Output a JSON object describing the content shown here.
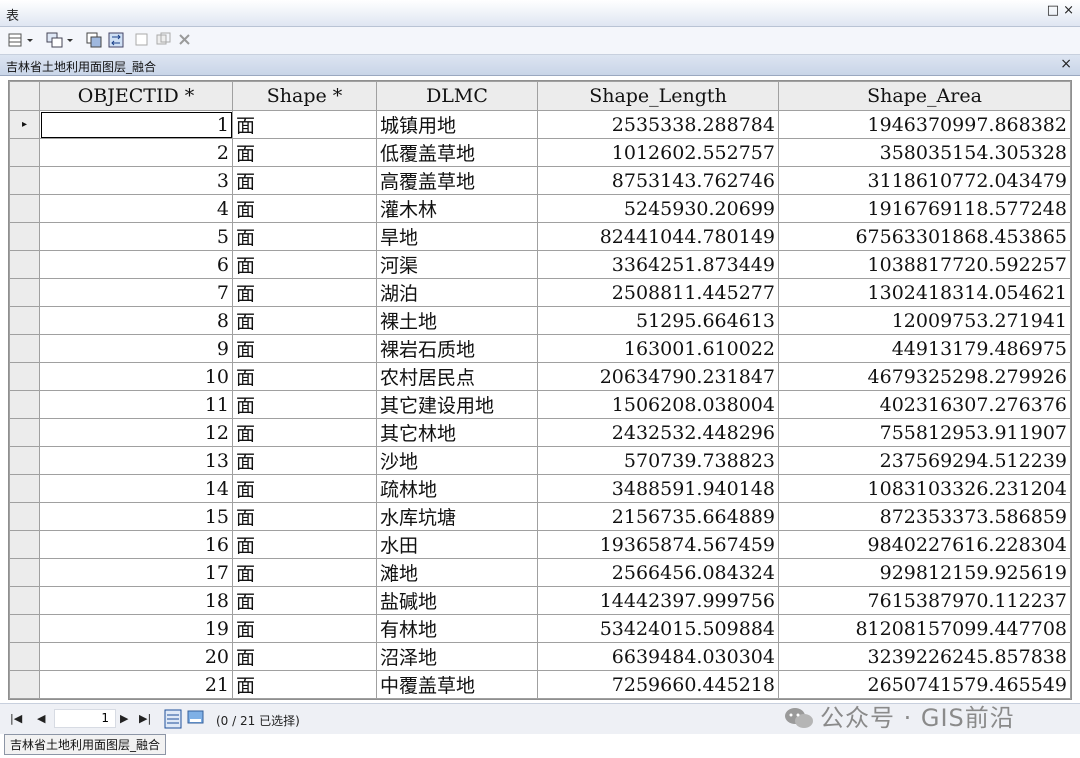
{
  "window": {
    "title": "表",
    "controls": "□ ×"
  },
  "tab": {
    "label": "吉林省土地利用面图层_融合",
    "close": "×"
  },
  "table": {
    "columns": [
      "OBJECTID *",
      "Shape *",
      "DLMC",
      "Shape_Length",
      "Shape_Area"
    ],
    "rows": [
      {
        "oid": "1",
        "shape": "面",
        "dlmc": "城镇用地",
        "len": "2535338.288784",
        "area": "1946370997.868382"
      },
      {
        "oid": "2",
        "shape": "面",
        "dlmc": "低覆盖草地",
        "len": "1012602.552757",
        "area": "358035154.305328"
      },
      {
        "oid": "3",
        "shape": "面",
        "dlmc": "高覆盖草地",
        "len": "8753143.762746",
        "area": "3118610772.043479"
      },
      {
        "oid": "4",
        "shape": "面",
        "dlmc": "灌木林",
        "len": "5245930.20699",
        "area": "1916769118.577248"
      },
      {
        "oid": "5",
        "shape": "面",
        "dlmc": "旱地",
        "len": "82441044.780149",
        "area": "67563301868.453865"
      },
      {
        "oid": "6",
        "shape": "面",
        "dlmc": "河渠",
        "len": "3364251.873449",
        "area": "1038817720.592257"
      },
      {
        "oid": "7",
        "shape": "面",
        "dlmc": "湖泊",
        "len": "2508811.445277",
        "area": "1302418314.054621"
      },
      {
        "oid": "8",
        "shape": "面",
        "dlmc": "裸土地",
        "len": "51295.664613",
        "area": "12009753.271941"
      },
      {
        "oid": "9",
        "shape": "面",
        "dlmc": "裸岩石质地",
        "len": "163001.610022",
        "area": "44913179.486975"
      },
      {
        "oid": "10",
        "shape": "面",
        "dlmc": "农村居民点",
        "len": "20634790.231847",
        "area": "4679325298.279926"
      },
      {
        "oid": "11",
        "shape": "面",
        "dlmc": "其它建设用地",
        "len": "1506208.038004",
        "area": "402316307.276376"
      },
      {
        "oid": "12",
        "shape": "面",
        "dlmc": "其它林地",
        "len": "2432532.448296",
        "area": "755812953.911907"
      },
      {
        "oid": "13",
        "shape": "面",
        "dlmc": "沙地",
        "len": "570739.738823",
        "area": "237569294.512239"
      },
      {
        "oid": "14",
        "shape": "面",
        "dlmc": "疏林地",
        "len": "3488591.940148",
        "area": "1083103326.231204"
      },
      {
        "oid": "15",
        "shape": "面",
        "dlmc": "水库坑塘",
        "len": "2156735.664889",
        "area": "872353373.586859"
      },
      {
        "oid": "16",
        "shape": "面",
        "dlmc": "水田",
        "len": "19365874.567459",
        "area": "9840227616.228304"
      },
      {
        "oid": "17",
        "shape": "面",
        "dlmc": "滩地",
        "len": "2566456.084324",
        "area": "929812159.925619"
      },
      {
        "oid": "18",
        "shape": "面",
        "dlmc": "盐碱地",
        "len": "14442397.999756",
        "area": "7615387970.112237"
      },
      {
        "oid": "19",
        "shape": "面",
        "dlmc": "有林地",
        "len": "53424015.509884",
        "area": "81208157099.447708"
      },
      {
        "oid": "20",
        "shape": "面",
        "dlmc": "沼泽地",
        "len": "6639484.030304",
        "area": "3239226245.857838"
      },
      {
        "oid": "21",
        "shape": "面",
        "dlmc": "中覆盖草地",
        "len": "7259660.445218",
        "area": "2650741579.465549"
      }
    ]
  },
  "status": {
    "page": "1",
    "count": "(0 / 21 已选择)"
  },
  "bottom_tab": {
    "label": "吉林省土地利用面图层_融合"
  },
  "watermark": {
    "text": "公众号 · GIS前沿"
  },
  "icons": [
    "table-options-icon",
    "related-tables-icon",
    "select-by-attributes-icon",
    "switch-selection-icon",
    "clear-selection-icon",
    "zoom-selected-icon",
    "delete-selected-icon",
    "first-record-icon",
    "previous-record-icon",
    "next-record-icon",
    "last-record-icon",
    "show-all-records-icon",
    "show-selected-records-icon",
    "wechat-icon"
  ]
}
